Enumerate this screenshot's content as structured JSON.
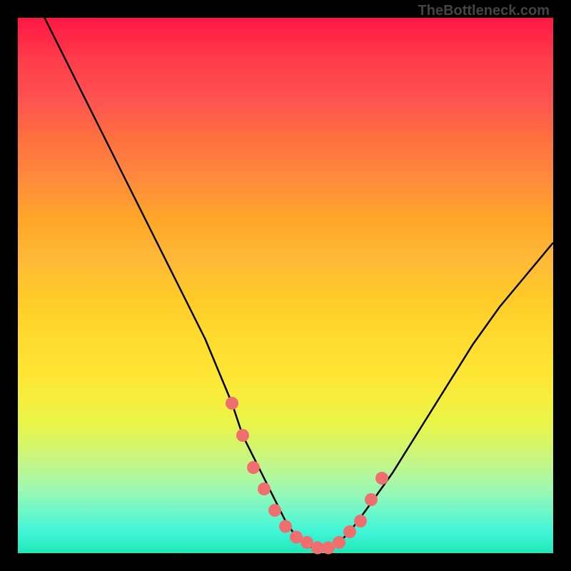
{
  "watermark": "TheBottleneck.com",
  "chart_data": {
    "type": "line",
    "title": "",
    "xlabel": "",
    "ylabel": "",
    "xlim": [
      0,
      100
    ],
    "ylim": [
      0,
      100
    ],
    "curve": {
      "name": "bottleneck-curve",
      "x": [
        5,
        10,
        15,
        20,
        25,
        30,
        35,
        40,
        42,
        45,
        48,
        50,
        52,
        55,
        58,
        60,
        62,
        65,
        70,
        75,
        80,
        85,
        90,
        95,
        100
      ],
      "y": [
        100,
        90,
        80,
        70,
        60,
        50,
        40,
        28,
        22,
        16,
        10,
        6,
        3,
        1,
        1,
        2,
        4,
        8,
        15,
        23,
        31,
        39,
        46,
        52,
        58
      ]
    },
    "markers": {
      "name": "highlighted-points",
      "color": "#ef6f6f",
      "x": [
        40,
        42,
        44,
        46,
        48,
        50,
        52,
        54,
        56,
        58,
        60,
        62,
        64,
        66,
        68
      ],
      "y": [
        28,
        22,
        16,
        12,
        8,
        5,
        3,
        2,
        1,
        1,
        2,
        4,
        6,
        10,
        14
      ]
    },
    "gradient_colors": {
      "top": "#ff1744",
      "mid_upper": "#ffa726",
      "mid": "#ffd92e",
      "mid_lower": "#d4f56a",
      "bottom": "#1de9b6"
    }
  }
}
